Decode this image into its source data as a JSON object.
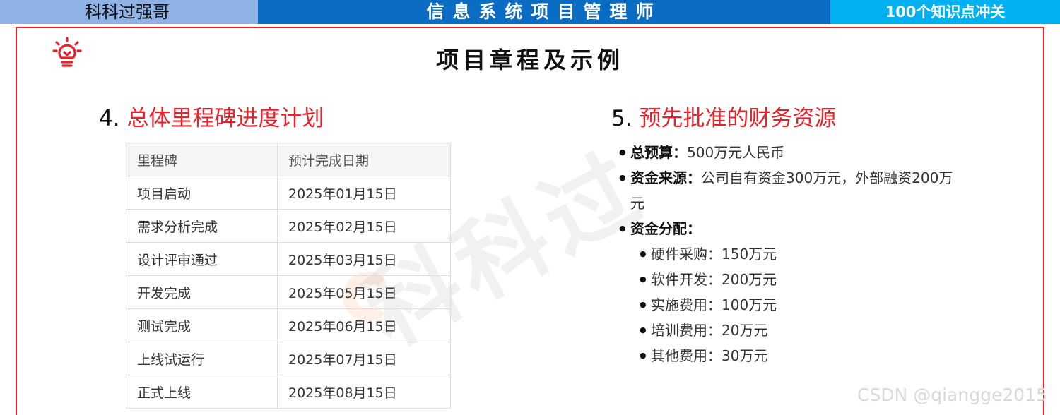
{
  "banner": {
    "left": "科科过强哥",
    "center": "信息系统项目管理师",
    "right": "100个知识点冲关"
  },
  "page_title": "项目章程及示例",
  "section4": {
    "number": "4.",
    "title": "总体里程碑进度计划",
    "table": {
      "headers": [
        "里程碑",
        "预计完成日期"
      ],
      "rows": [
        [
          "项目启动",
          "2025年01月15日"
        ],
        [
          "需求分析完成",
          "2025年02月15日"
        ],
        [
          "设计评审通过",
          "2025年03月15日"
        ],
        [
          "开发完成",
          "2025年05月15日"
        ],
        [
          "测试完成",
          "2025年06月15日"
        ],
        [
          "上线试运行",
          "2025年07月15日"
        ],
        [
          "正式上线",
          "2025年08月15日"
        ]
      ]
    }
  },
  "section5": {
    "number": "5.",
    "title": "预先批准的财务资源",
    "items": [
      {
        "label": "总预算",
        "sep": "：",
        "value": "500万元人民币"
      },
      {
        "label": "资金来源",
        "sep": "：",
        "value": "公司自有资金300万元，外部融资200万元"
      },
      {
        "label": "资金分配",
        "sep": "：",
        "value": ""
      }
    ],
    "allocation": [
      "硬件采购：150万元",
      "软件开发：200万元",
      "实施费用：100万元",
      "培训费用：20万元",
      "其他费用：30万元"
    ]
  },
  "watermark": "科科过",
  "credit": "CSDN @qiangge2015",
  "colors": {
    "accent_red": "#e8212a",
    "banner_blue": "#0b6cc4",
    "banner_cyan": "#00b0f0",
    "banner_light": "#8fb3e6"
  },
  "icons": {
    "logo": "lightbulb-icon"
  }
}
